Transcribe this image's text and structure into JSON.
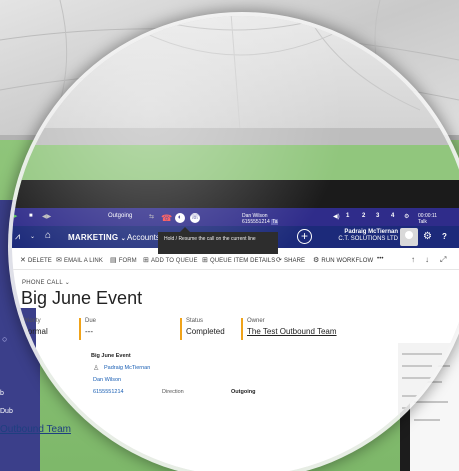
{
  "phone_toolbar": {
    "status": "Outgoing",
    "caller_name": "Dan Wilson",
    "caller_number": "6155551214",
    "number_tag": "Ta",
    "speed_dials": [
      "1",
      "2",
      "3",
      "4"
    ],
    "timer": "00:00:11",
    "timer_label": "Talk"
  },
  "tooltip": {
    "text": "Hold / Resume the call on the current line"
  },
  "nav": {
    "module": "MARKETING",
    "entity": "Accounts",
    "user_name": "Padraig McTiernan",
    "org": "C.T. SOLUTIONS LTD",
    "help": "?"
  },
  "commands": {
    "delete": "DELETE",
    "email_link": "EMAIL A LINK",
    "form": "FORM",
    "add_to_queue": "ADD TO QUEUE",
    "queue_item_details": "QUEUE ITEM DETAILS",
    "share": "SHARE",
    "run_workflow": "RUN WORKFLOW",
    "more": "•••"
  },
  "record": {
    "type": "PHONE CALL",
    "title": "Big June Event",
    "priority_label": "Priority",
    "priority_value": "Normal",
    "due_label": "Due",
    "due_value": "---",
    "status_label": "Status",
    "status_value": "Completed",
    "owner_label": "Owner",
    "owner_value": "The Test Outbound Team"
  },
  "section": {
    "subject": "Big June Event",
    "from": "Padraig McTiernan",
    "to": "Dan Wilson",
    "phone": "6155551214",
    "direction_label": "Direction",
    "direction_value": "Outgoing"
  },
  "background": {
    "sidebar_items": [
      "b",
      "Dub"
    ],
    "team_link": "Outbound Team",
    "right_link": "The Test Outbound Team"
  },
  "colors": {
    "phone_bar": "#2f2c8a",
    "nav_bar": "#1c2a7a",
    "accent_bar": "#f0a31a",
    "link": "#1a5fb4"
  }
}
